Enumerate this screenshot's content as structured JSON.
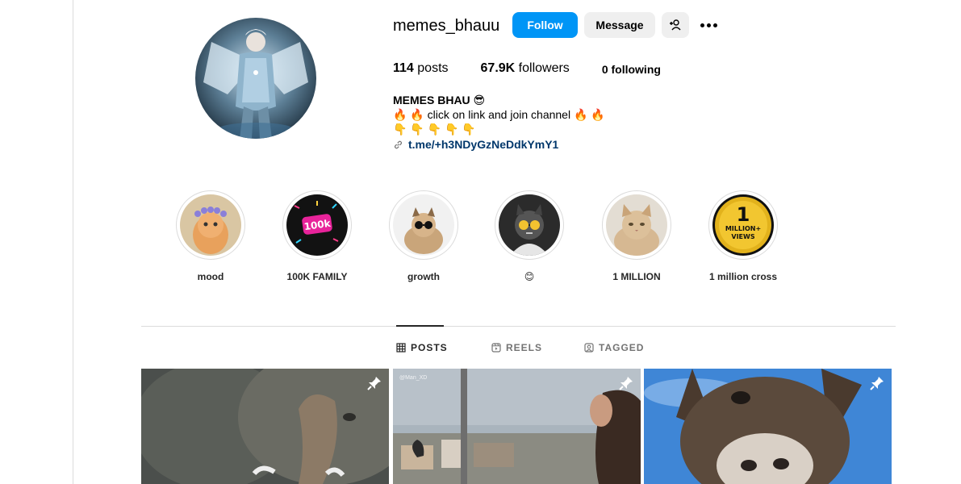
{
  "profile": {
    "username": "memes_bhauu",
    "buttons": {
      "follow": "Follow",
      "message": "Message"
    },
    "stats": {
      "posts_count": "114",
      "posts_label": "posts",
      "followers_count": "67.9K",
      "followers_label": "followers",
      "following_count": "0",
      "following_label": "following"
    },
    "bio": {
      "name": "MEMES BHAU 😎",
      "line1": "🔥 🔥 click on link and join channel 🔥 🔥",
      "line2": "👇 👇 👇 👇 👇",
      "link": "t.me/+h3NDyGzNeDdkYmY1"
    }
  },
  "highlights": [
    {
      "label": "mood"
    },
    {
      "label": "100K FAMILY",
      "badge": "100k"
    },
    {
      "label": "growth"
    },
    {
      "label": "😊"
    },
    {
      "label": "1 MILLION"
    },
    {
      "label": "1 million cross",
      "badge_big": "1",
      "badge_line1": "MILLION+",
      "badge_line2": "VIEWS"
    }
  ],
  "tabs": [
    {
      "label": "POSTS",
      "active": true,
      "icon": "grid-icon"
    },
    {
      "label": "REELS",
      "active": false,
      "icon": "reels-icon"
    },
    {
      "label": "TAGGED",
      "active": false,
      "icon": "tagged-icon"
    }
  ],
  "posts": [
    {
      "pinned": true,
      "subject": "elephant"
    },
    {
      "pinned": true,
      "subject": "rooftop",
      "watermark": "@Man_XD"
    },
    {
      "pinned": true,
      "subject": "donkey"
    }
  ],
  "colors": {
    "accent": "#0095f6",
    "link": "#00376b",
    "border": "#dbdbdb",
    "secondary_button": "#efefef"
  }
}
